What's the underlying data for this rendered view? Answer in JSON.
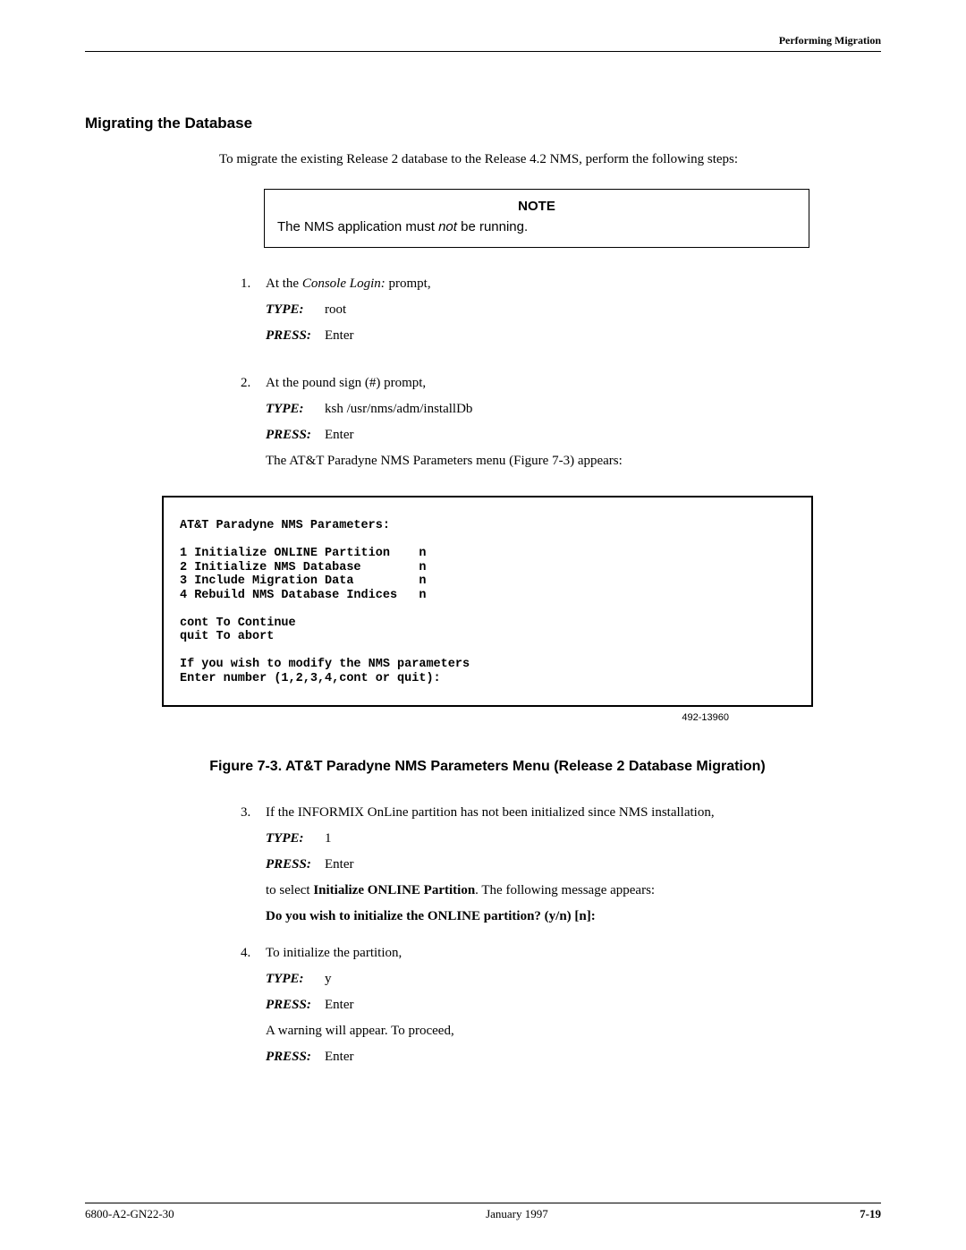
{
  "header": {
    "right": "Performing Migration"
  },
  "section_heading": "Migrating the Database",
  "intro": "To migrate the existing Release 2 database to the Release 4.2 NMS, perform the following steps:",
  "note": {
    "title": "NOTE",
    "pre": "The NMS application must ",
    "em": "not",
    "post": " be running."
  },
  "steps": {
    "s1": {
      "num": "1.",
      "line1_pre": "At the ",
      "line1_em": "Console Login:",
      "line1_post": " prompt,",
      "type_label": "TYPE:",
      "type_val": "root",
      "press_label": "PRESS:",
      "press_val": "Enter"
    },
    "s2": {
      "num": "2.",
      "line1": "At the pound sign (#) prompt,",
      "type_label": "TYPE:",
      "type_val": "ksh /usr/nms/adm/installDb",
      "press_label": "PRESS:",
      "press_val": "Enter",
      "tail": "The AT&T Paradyne NMS Parameters menu (Figure 7-3) appears:"
    },
    "s3": {
      "num": "3.",
      "line1": "If the INFORMIX OnLine partition has not been initialized since NMS installation,",
      "type_label": "TYPE:",
      "type_val": "1",
      "press_label": "PRESS:",
      "press_val": "Enter",
      "mid_pre": "to select ",
      "mid_bold": "Initialize ONLINE Partition",
      "mid_post": ". The following message appears:",
      "msg": "Do you wish to initialize the ONLINE partition? (y/n) [n]:"
    },
    "s4": {
      "num": "4.",
      "line1": "To initialize the partition,",
      "type_label": "TYPE:",
      "type_val": "y",
      "press_label": "PRESS:",
      "press_val": "Enter",
      "mid": "A warning will appear. To proceed,",
      "press2_label": "PRESS:",
      "press2_val": "Enter"
    }
  },
  "terminal": "AT&T Paradyne NMS Parameters:\n\n1 Initialize ONLINE Partition    n\n2 Initialize NMS Database        n\n3 Include Migration Data         n\n4 Rebuild NMS Database Indices   n\n\ncont To Continue\nquit To abort\n\nIf you wish to modify the NMS parameters\nEnter number (1,2,3,4,cont or quit):",
  "fig_ref": "492-13960",
  "figure_caption": "Figure 7-3.  AT&T Paradyne NMS Parameters Menu (Release 2 Database Migration)",
  "footer": {
    "left": "6800-A2-GN22-30",
    "center": "January 1997",
    "right": "7-19"
  }
}
